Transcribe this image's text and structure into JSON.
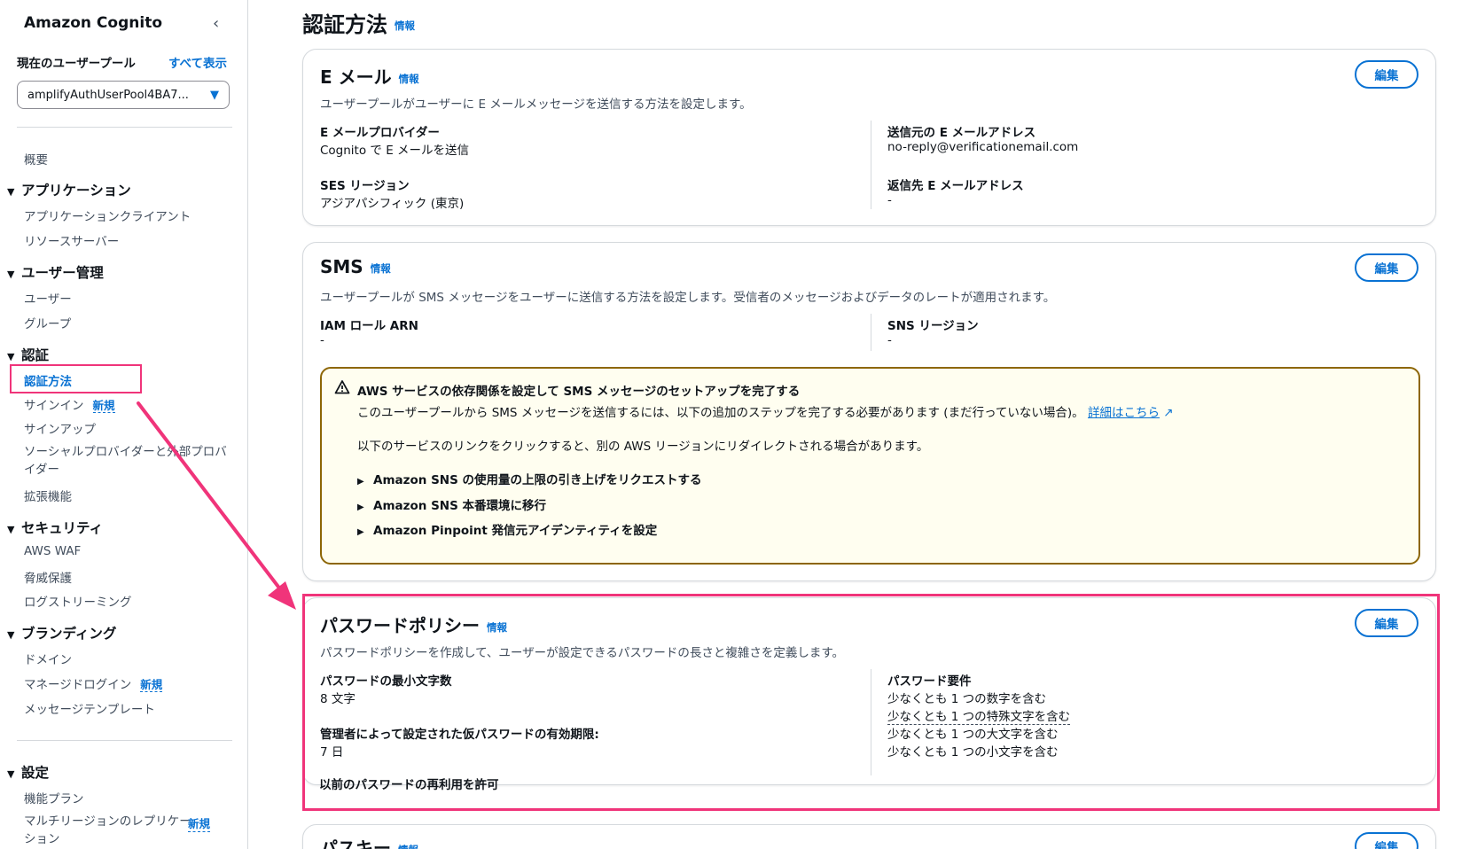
{
  "sidebar": {
    "title": "Amazon Cognito",
    "pool_label": "現在のユーザープール",
    "pool_all": "すべて表示",
    "pool_selected": "amplifyAuthUserPool4BA7...",
    "overview": "概要",
    "groups": {
      "applications": {
        "label": "アプリケーション",
        "items": [
          "アプリケーションクライアント",
          "リソースサーバー"
        ]
      },
      "users": {
        "label": "ユーザー管理",
        "items": [
          "ユーザー",
          "グループ"
        ]
      },
      "auth": {
        "label": "認証",
        "items": [
          "認証方法",
          "サインイン",
          "サインアップ",
          "ソーシャルプロバイダーと外部プロバイダー",
          "拡張機能"
        ]
      },
      "security": {
        "label": "セキュリティ",
        "items": [
          "AWS WAF",
          "脅威保護",
          "ログストリーミング"
        ]
      },
      "branding": {
        "label": "ブランディング",
        "items": [
          "ドメイン",
          "マネージドログイン",
          "メッセージテンプレート"
        ]
      },
      "settings": {
        "label": "設定",
        "items": [
          "機能プラン",
          "マルチリージョンのレプリケーション"
        ]
      }
    },
    "new_badge": "新規"
  },
  "main": {
    "page_title": "認証方法",
    "info": "情報",
    "edit": "編集",
    "email": {
      "title": "E メール",
      "desc": "ユーザープールがユーザーに E メールメッセージを送信する方法を設定します。",
      "provider_label": "E メールプロバイダー",
      "provider_value": "Cognito で E メールを送信",
      "ses_label": "SES リージョン",
      "ses_value": "アジアパシフィック (東京)",
      "from_label": "送信元の E メールアドレス",
      "from_value": "no-reply@verificationemail.com",
      "reply_label": "返信先 E メールアドレス",
      "reply_value": "-"
    },
    "sms": {
      "title": "SMS",
      "desc": "ユーザープールが SMS メッセージをユーザーに送信する方法を設定します。受信者のメッセージおよびデータのレートが適用されます。",
      "iam_label": "IAM ロール ARN",
      "iam_value": "-",
      "sns_label": "SNS リージョン",
      "sns_value": "-",
      "alert": {
        "title": "AWS サービスの依存関係を設定して SMS メッセージのセットアップを完了する",
        "line1": "このユーザープールから SMS メッセージを送信するには、以下の追加のステップを完了する必要があります (まだ行っていない場合)。",
        "link": "詳細はこちら",
        "line2": "以下のサービスのリンクをクリックすると、別の AWS リージョンにリダイレクトされる場合があります。",
        "items": [
          "Amazon SNS の使用量の上限の引き上げをリクエストする",
          "Amazon SNS 本番環境に移行",
          "Amazon Pinpoint 発信元アイデンティティを設定"
        ]
      }
    },
    "password": {
      "title": "パスワードポリシー",
      "desc": "パスワードポリシーを作成して、ユーザーが設定できるパスワードの長さと複雑さを定義します。",
      "min_label": "パスワードの最小文字数",
      "min_value": "8 文字",
      "temp_label": "管理者によって設定された仮パスワードの有効期限:",
      "temp_value": "7 日",
      "reuse_label": "以前のパスワードの再利用を許可",
      "req_label": "パスワード要件",
      "req_items": [
        "少なくとも 1 つの数字を含む",
        "少なくとも 1 つの特殊文字を含む",
        "少なくとも 1 つの大文字を含む",
        "少なくとも 1 つの小文字を含む"
      ]
    },
    "passkey": {
      "title": "パスキー"
    }
  },
  "colors": {
    "accent": "#0972d3",
    "annotation": "#f0347a",
    "warning_border": "#8d6605"
  }
}
